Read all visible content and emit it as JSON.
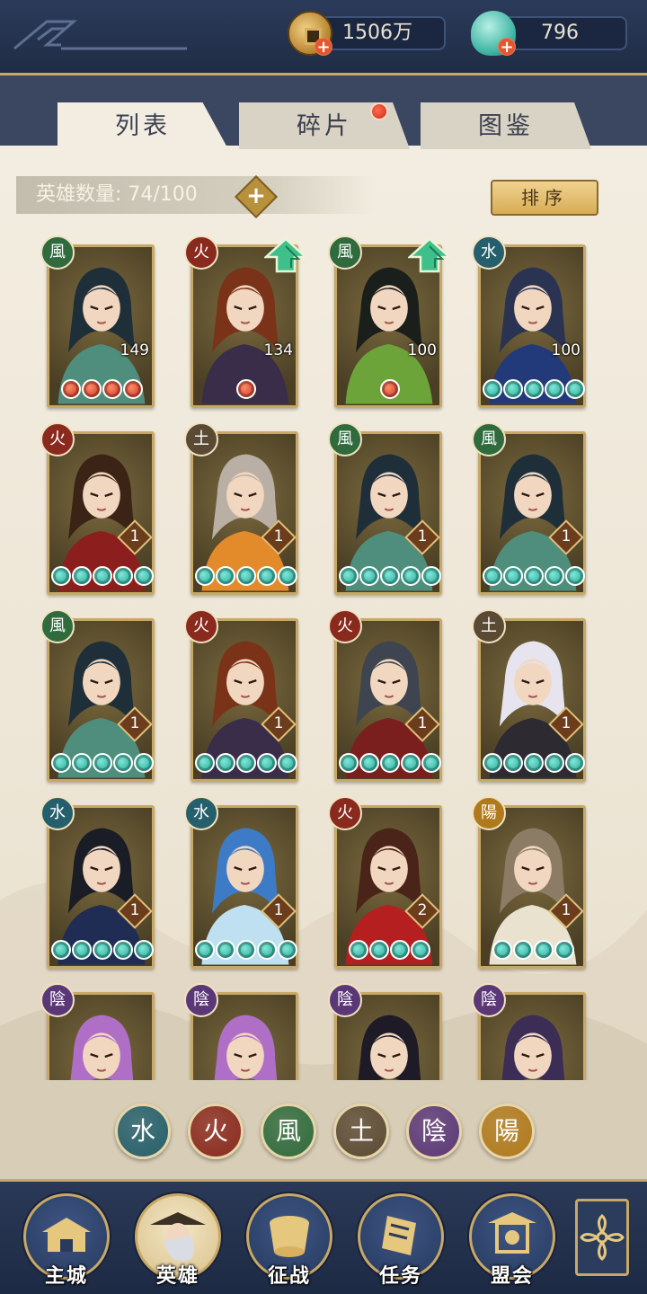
{
  "currency": {
    "gold": "1506万",
    "jade": "796"
  },
  "tabs": [
    {
      "label": "列表",
      "active": true
    },
    {
      "label": "碎片",
      "active": false,
      "has_notification": true
    },
    {
      "label": "图鉴",
      "active": false
    }
  ],
  "hero_count": {
    "label": "英雄数量: 74/100"
  },
  "sort_button": "排序",
  "heroes": [
    {
      "element": "風",
      "element_color": "#2f6b3c",
      "level": "149",
      "stars": 4,
      "star_color": "red",
      "upgrade": false
    },
    {
      "element": "火",
      "element_color": "#8a2a1e",
      "level": "134",
      "stars": 1,
      "star_color": "red",
      "upgrade": true
    },
    {
      "element": "風",
      "element_color": "#2f6b3c",
      "level": "100",
      "stars": 1,
      "star_color": "red",
      "upgrade": true
    },
    {
      "element": "水",
      "element_color": "#245f6b",
      "level": "100",
      "stars": 5,
      "star_color": "green",
      "upgrade": false
    },
    {
      "element": "火",
      "element_color": "#8a2a1e",
      "level": "1",
      "stars": 5,
      "star_color": "green",
      "upgrade": false
    },
    {
      "element": "土",
      "element_color": "#5a4a34",
      "level": "1",
      "stars": 5,
      "star_color": "green",
      "upgrade": false
    },
    {
      "element": "風",
      "element_color": "#2f6b3c",
      "level": "1",
      "stars": 5,
      "star_color": "green",
      "upgrade": false
    },
    {
      "element": "風",
      "element_color": "#2f6b3c",
      "level": "1",
      "stars": 5,
      "star_color": "green",
      "upgrade": false
    },
    {
      "element": "風",
      "element_color": "#2f6b3c",
      "level": "1",
      "stars": 5,
      "star_color": "green",
      "upgrade": false
    },
    {
      "element": "火",
      "element_color": "#8a2a1e",
      "level": "1",
      "stars": 5,
      "star_color": "green",
      "upgrade": false
    },
    {
      "element": "火",
      "element_color": "#8a2a1e",
      "level": "1",
      "stars": 5,
      "star_color": "green",
      "upgrade": false
    },
    {
      "element": "土",
      "element_color": "#5a4a34",
      "level": "1",
      "stars": 5,
      "star_color": "green",
      "upgrade": false
    },
    {
      "element": "水",
      "element_color": "#245f6b",
      "level": "1",
      "stars": 5,
      "star_color": "green",
      "upgrade": false
    },
    {
      "element": "水",
      "element_color": "#245f6b",
      "level": "1",
      "stars": 5,
      "star_color": "green",
      "upgrade": false
    },
    {
      "element": "火",
      "element_color": "#8a2a1e",
      "level": "2",
      "stars": 4,
      "star_color": "green",
      "upgrade": false
    },
    {
      "element": "陽",
      "element_color": "#b07a1c",
      "level": "1",
      "stars": 4,
      "star_color": "green",
      "upgrade": false
    },
    {
      "element": "陰",
      "element_color": "#5b3777",
      "level": "",
      "stars": 0,
      "star_color": "green",
      "upgrade": false
    },
    {
      "element": "陰",
      "element_color": "#5b3777",
      "level": "",
      "stars": 0,
      "star_color": "green",
      "upgrade": false
    },
    {
      "element": "陰",
      "element_color": "#5b3777",
      "level": "",
      "stars": 0,
      "star_color": "green",
      "upgrade": false
    },
    {
      "element": "陰",
      "element_color": "#5b3777",
      "level": "",
      "stars": 0,
      "star_color": "green",
      "upgrade": false
    }
  ],
  "element_filters": [
    {
      "glyph": "水",
      "color": "#245f6b"
    },
    {
      "glyph": "火",
      "color": "#8a2a1e"
    },
    {
      "glyph": "風",
      "color": "#2f6b3c"
    },
    {
      "glyph": "土",
      "color": "#5a4a34"
    },
    {
      "glyph": "陰",
      "color": "#5b3777"
    },
    {
      "glyph": "陽",
      "color": "#b07a1c"
    }
  ],
  "nav": [
    {
      "label": "主城",
      "icon": "palace-icon",
      "active": false
    },
    {
      "label": "英雄",
      "icon": "hero-icon",
      "active": true
    },
    {
      "label": "征战",
      "icon": "drum-icon",
      "active": false
    },
    {
      "label": "任务",
      "icon": "scroll-icon",
      "active": false
    },
    {
      "label": "盟会",
      "icon": "pavilion-icon",
      "active": false
    }
  ],
  "colors": {
    "gold_trim": "#c8a866",
    "navy": "#1f2d47",
    "parchment": "#f3ede1"
  }
}
